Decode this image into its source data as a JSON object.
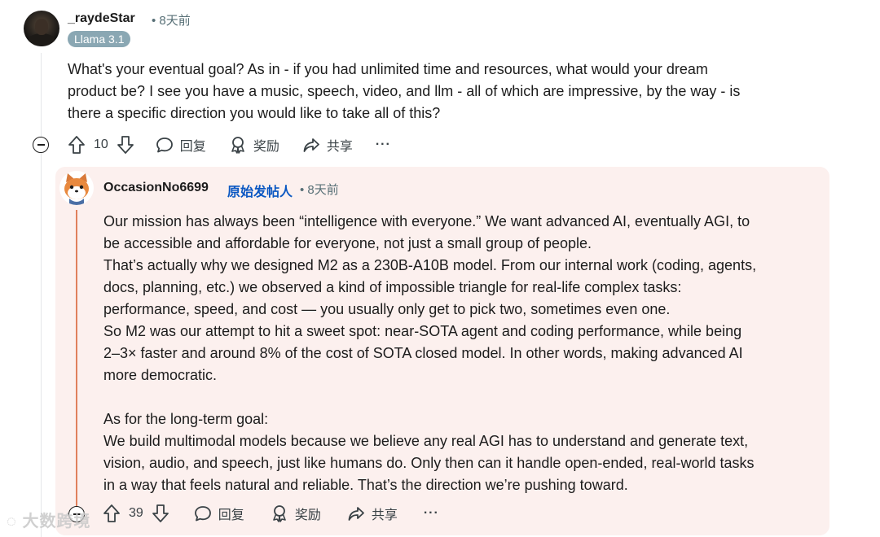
{
  "comment1": {
    "username": "_raydeStar",
    "time": "8天前",
    "flair": "Llama 3.1",
    "body": [
      "What's your eventual goal? As in - if you had unlimited time and resources, what would your dream",
      "product be? I see you have a music, speech, video, and llm - all of which are impressive, by the way - is",
      "there a specific direction you would like to take all of this?"
    ],
    "actions": {
      "votes": "10",
      "reply": "回复",
      "award": "奖励",
      "share": "共享",
      "more": "···"
    }
  },
  "comment2": {
    "username": "OccasionNo6699",
    "op_badge": "原始发帖人",
    "time": "8天前",
    "body": [
      "Our mission has always been “intelligence with everyone.” We want advanced AI, eventually AGI, to",
      "be accessible and affordable for everyone, not just a small group of people.",
      "That’s actually why we designed M2 as a 230B-A10B model. From our internal work (coding, agents,",
      "docs, planning, etc.) we observed a kind of impossible triangle for real-life complex tasks:",
      "performance, speed, and cost — you usually only get to pick two, sometimes even one.",
      "So M2 was our attempt to hit a sweet spot: near-SOTA agent and coding performance, while being",
      "2–3× faster and around 8% of the cost of SOTA closed model. In other words, making advanced AI",
      "more democratic."
    ],
    "body2": [
      "As for the long-term goal:",
      "We build multimodal models because we believe any real AGI has to understand and generate text,",
      "vision, audio, and speech, just like humans do. Only then can it handle open-ended, real-world tasks",
      "in a way that feels natural and reliable. That’s the direction we’re pushing toward."
    ],
    "actions": {
      "votes": "39",
      "reply": "回复",
      "award": "奖励",
      "share": "共享",
      "more": "···"
    }
  },
  "watermark": "大数跨境",
  "colors": {
    "accent_line": "#e0805c",
    "reply_bg": "#fcf0ee",
    "op_blue": "#0a57c2",
    "flair_bg": "#8aa7b3"
  }
}
